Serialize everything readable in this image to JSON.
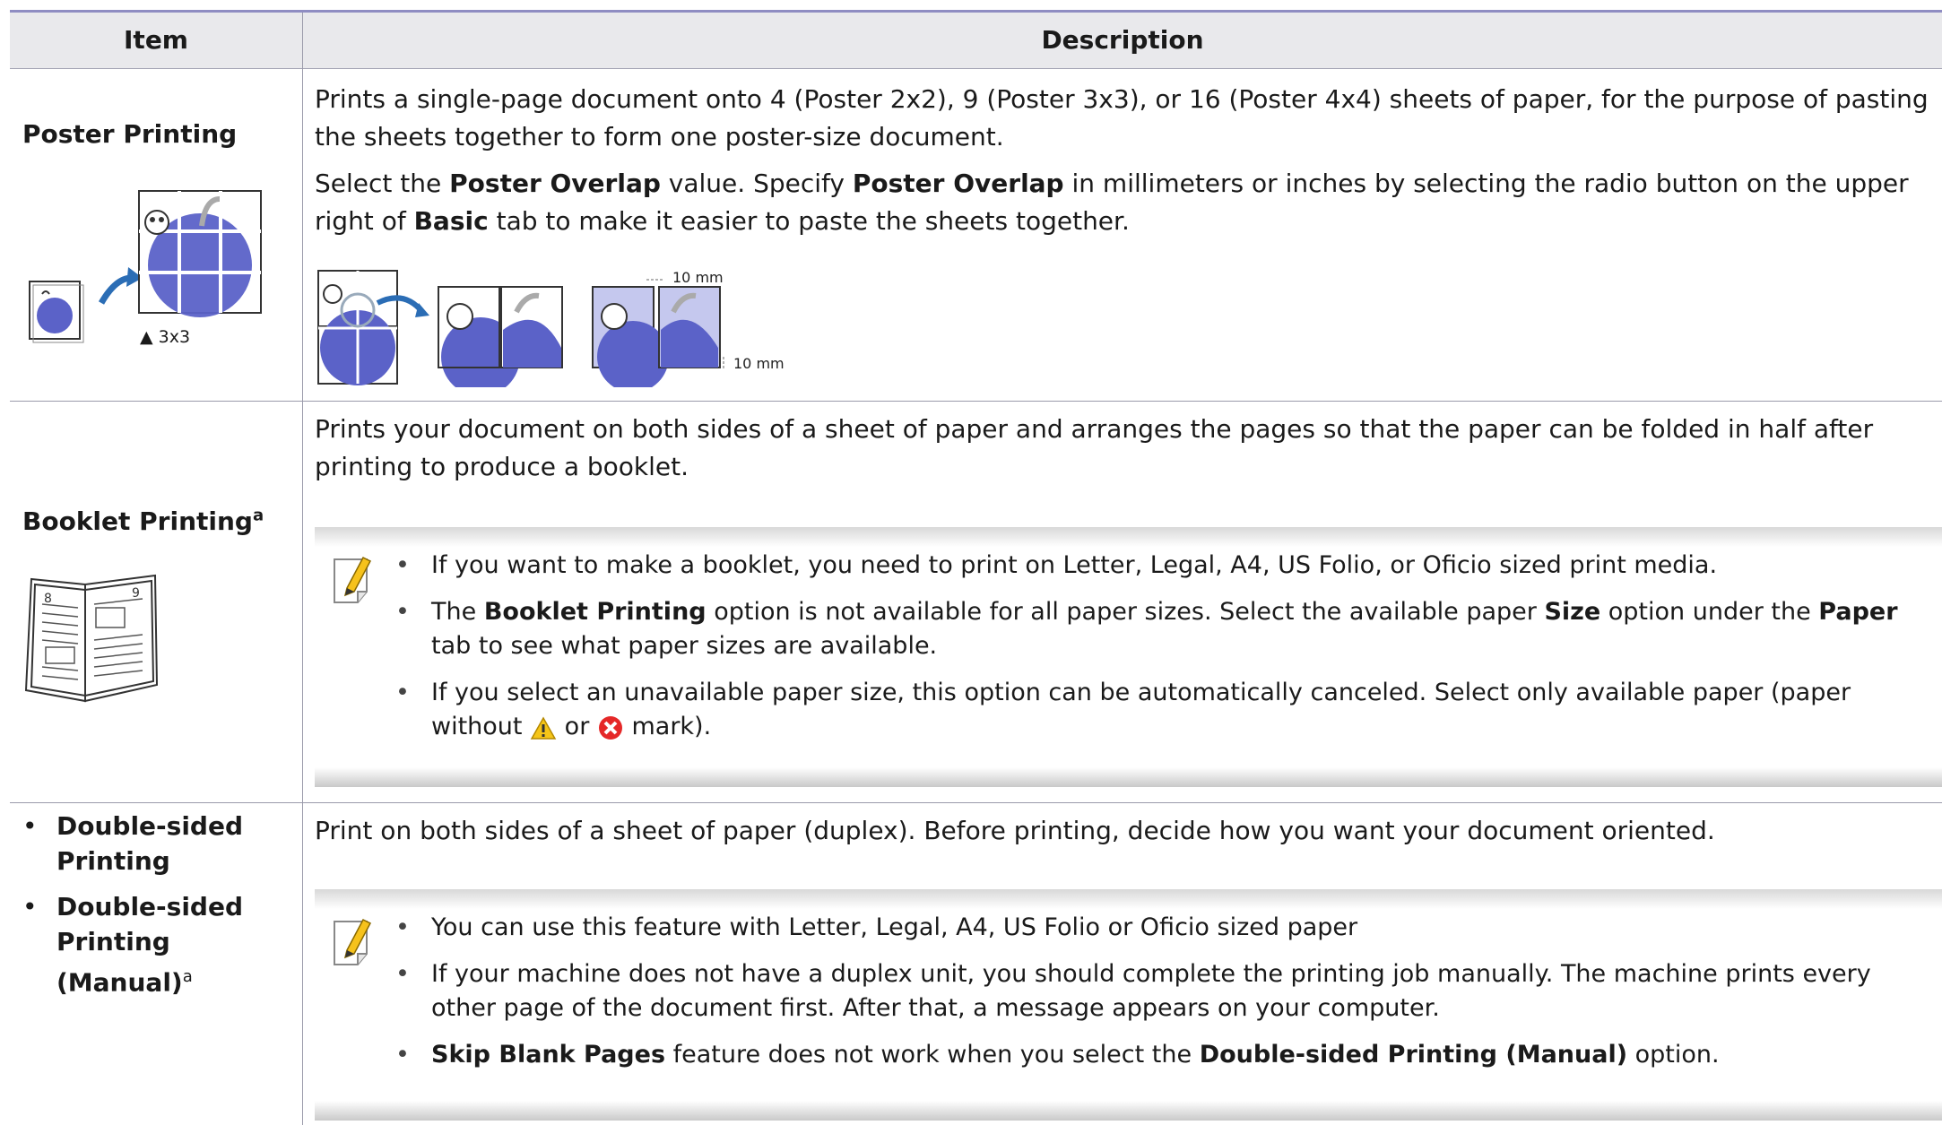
{
  "table": {
    "header_item": "Item",
    "header_description": "Description"
  },
  "rows": {
    "poster": {
      "title": "Poster Printing",
      "figure_label": "3x3",
      "para1_a": "Prints a single-page document onto 4 (Poster 2x2), 9 (Poster 3x3), or 16 (Poster 4x4) sheets of paper, for the purpose of pasting the sheets together to form one poster-size document.",
      "para2_a": "Select the ",
      "para2_b": "Poster Overlap",
      "para2_c": " value. Specify ",
      "para2_d": "Poster Overlap",
      "para2_e": " in millimeters or inches by selecting the radio button on the upper right of ",
      "para2_f": "Basic",
      "para2_g": " tab to make it easier to paste the sheets together.",
      "overlap_label_top": "10 mm",
      "overlap_label_right": "10 mm"
    },
    "booklet": {
      "title": "Booklet Printing",
      "title_sup": "a",
      "para": "Prints your document on both sides of a sheet of paper and arranges the pages so that the paper can be folded in half after printing to produce a booklet.",
      "note1": "If you want to make a booklet, you need to print on Letter, Legal, A4, US Folio, or Oficio sized print media.",
      "note2_a": "The ",
      "note2_b": "Booklet Printing",
      "note2_c": " option is not available for all paper sizes. Select the available paper ",
      "note2_d": "Size",
      "note2_e": " option under the ",
      "note2_f": "Paper",
      "note2_g": " tab to see what paper sizes are available.",
      "note3_a": "If you select an unavailable paper size, this option can be automatically canceled. Select only available paper (paper without ",
      "note3_b": " or ",
      "note3_c": " mark)."
    },
    "duplex": {
      "item1": "Double-sided Printing",
      "item2": "Double-sided Printing (Manual)",
      "item2_sup": "a",
      "para": "Print on both sides of a sheet of paper (duplex). Before printing, decide how you want your document oriented.",
      "note1": "You can use this feature with Letter, Legal, A4, US Folio or Oficio sized paper",
      "note2": "If your machine does not have a duplex unit, you should complete the printing job manually. The machine prints every other page of the document first. After that, a message appears on your computer.",
      "note3_a": "Skip Blank Pages",
      "note3_b": " feature does not work when you select the ",
      "note3_c": "Double-sided Printing (Manual)",
      "note3_d": " option."
    }
  },
  "colors": {
    "header_bg": "#e9e9ec",
    "top_rule": "#8f8dc2",
    "apple_blue": "#5b62c8",
    "arrow_blue": "#2b6db5"
  },
  "icons": [
    "note-pencil-icon",
    "warning-triangle-icon",
    "error-x-icon",
    "arrow-right-icon"
  ]
}
